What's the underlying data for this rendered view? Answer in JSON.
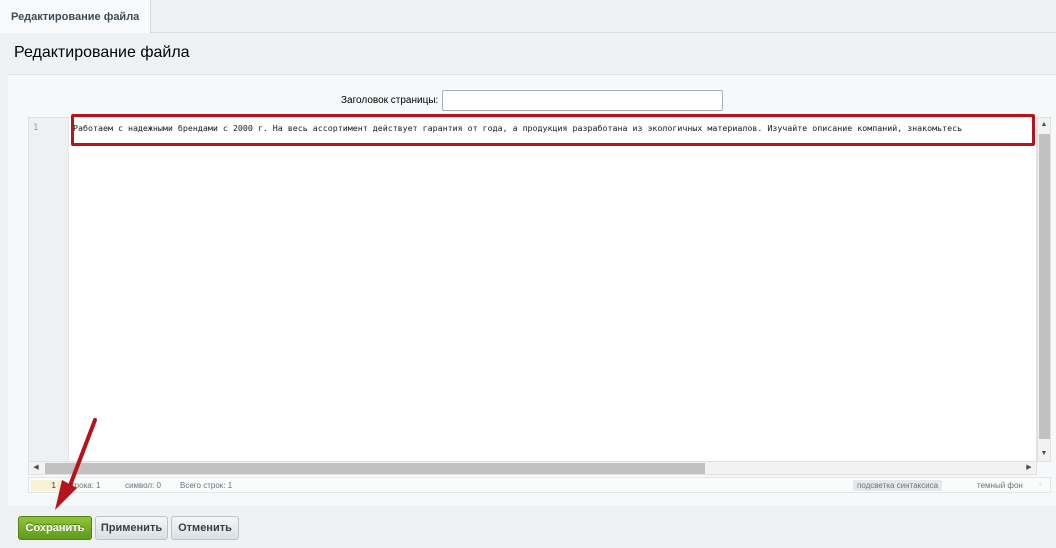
{
  "tabs": [
    {
      "label": "Редактирование файла"
    }
  ],
  "page": {
    "title": "Редактирование файла"
  },
  "form": {
    "title_label": "Заголовок страницы:",
    "title_value": "",
    "title_placeholder": ""
  },
  "editor": {
    "line_numbers": [
      "1"
    ],
    "lines": [
      "Работаем с надежными брендами с 2000 г. На весь ассортимент действует гарантия от года, а продукция разработана из экологичных материалов. Изучайте описание компаний, знакомьтесь"
    ]
  },
  "statusbar": {
    "position": "1",
    "line": "строка: 1",
    "symbol": "символ: 0",
    "total": "Всего строк: 1",
    "syntax": "подсветка синтаксиса",
    "theme": "темный фон",
    "grip": "◦"
  },
  "buttons": {
    "save": "Сохранить",
    "apply": "Применить",
    "cancel": "Отменить"
  },
  "annotation_colors": {
    "highlight": "#b5141c",
    "arrow": "#b5141c"
  },
  "icons": {
    "scroll_up": "▲",
    "scroll_down": "▼",
    "scroll_left": "◀",
    "scroll_right": "▶"
  }
}
